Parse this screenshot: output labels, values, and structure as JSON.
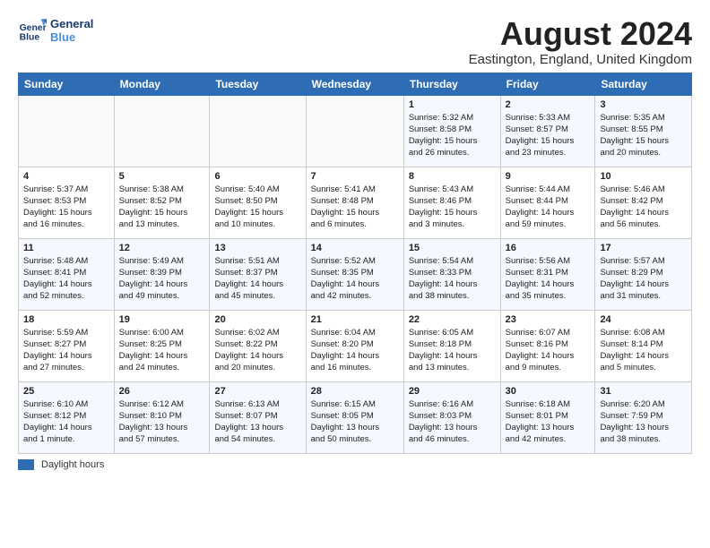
{
  "header": {
    "logo_line1": "General",
    "logo_line2": "Blue",
    "month_title": "August 2024",
    "location": "Eastington, England, United Kingdom"
  },
  "weekdays": [
    "Sunday",
    "Monday",
    "Tuesday",
    "Wednesday",
    "Thursday",
    "Friday",
    "Saturday"
  ],
  "weeks": [
    [
      {
        "day": "",
        "info": ""
      },
      {
        "day": "",
        "info": ""
      },
      {
        "day": "",
        "info": ""
      },
      {
        "day": "",
        "info": ""
      },
      {
        "day": "1",
        "info": "Sunrise: 5:32 AM\nSunset: 8:58 PM\nDaylight: 15 hours\nand 26 minutes."
      },
      {
        "day": "2",
        "info": "Sunrise: 5:33 AM\nSunset: 8:57 PM\nDaylight: 15 hours\nand 23 minutes."
      },
      {
        "day": "3",
        "info": "Sunrise: 5:35 AM\nSunset: 8:55 PM\nDaylight: 15 hours\nand 20 minutes."
      }
    ],
    [
      {
        "day": "4",
        "info": "Sunrise: 5:37 AM\nSunset: 8:53 PM\nDaylight: 15 hours\nand 16 minutes."
      },
      {
        "day": "5",
        "info": "Sunrise: 5:38 AM\nSunset: 8:52 PM\nDaylight: 15 hours\nand 13 minutes."
      },
      {
        "day": "6",
        "info": "Sunrise: 5:40 AM\nSunset: 8:50 PM\nDaylight: 15 hours\nand 10 minutes."
      },
      {
        "day": "7",
        "info": "Sunrise: 5:41 AM\nSunset: 8:48 PM\nDaylight: 15 hours\nand 6 minutes."
      },
      {
        "day": "8",
        "info": "Sunrise: 5:43 AM\nSunset: 8:46 PM\nDaylight: 15 hours\nand 3 minutes."
      },
      {
        "day": "9",
        "info": "Sunrise: 5:44 AM\nSunset: 8:44 PM\nDaylight: 14 hours\nand 59 minutes."
      },
      {
        "day": "10",
        "info": "Sunrise: 5:46 AM\nSunset: 8:42 PM\nDaylight: 14 hours\nand 56 minutes."
      }
    ],
    [
      {
        "day": "11",
        "info": "Sunrise: 5:48 AM\nSunset: 8:41 PM\nDaylight: 14 hours\nand 52 minutes."
      },
      {
        "day": "12",
        "info": "Sunrise: 5:49 AM\nSunset: 8:39 PM\nDaylight: 14 hours\nand 49 minutes."
      },
      {
        "day": "13",
        "info": "Sunrise: 5:51 AM\nSunset: 8:37 PM\nDaylight: 14 hours\nand 45 minutes."
      },
      {
        "day": "14",
        "info": "Sunrise: 5:52 AM\nSunset: 8:35 PM\nDaylight: 14 hours\nand 42 minutes."
      },
      {
        "day": "15",
        "info": "Sunrise: 5:54 AM\nSunset: 8:33 PM\nDaylight: 14 hours\nand 38 minutes."
      },
      {
        "day": "16",
        "info": "Sunrise: 5:56 AM\nSunset: 8:31 PM\nDaylight: 14 hours\nand 35 minutes."
      },
      {
        "day": "17",
        "info": "Sunrise: 5:57 AM\nSunset: 8:29 PM\nDaylight: 14 hours\nand 31 minutes."
      }
    ],
    [
      {
        "day": "18",
        "info": "Sunrise: 5:59 AM\nSunset: 8:27 PM\nDaylight: 14 hours\nand 27 minutes."
      },
      {
        "day": "19",
        "info": "Sunrise: 6:00 AM\nSunset: 8:25 PM\nDaylight: 14 hours\nand 24 minutes."
      },
      {
        "day": "20",
        "info": "Sunrise: 6:02 AM\nSunset: 8:22 PM\nDaylight: 14 hours\nand 20 minutes."
      },
      {
        "day": "21",
        "info": "Sunrise: 6:04 AM\nSunset: 8:20 PM\nDaylight: 14 hours\nand 16 minutes."
      },
      {
        "day": "22",
        "info": "Sunrise: 6:05 AM\nSunset: 8:18 PM\nDaylight: 14 hours\nand 13 minutes."
      },
      {
        "day": "23",
        "info": "Sunrise: 6:07 AM\nSunset: 8:16 PM\nDaylight: 14 hours\nand 9 minutes."
      },
      {
        "day": "24",
        "info": "Sunrise: 6:08 AM\nSunset: 8:14 PM\nDaylight: 14 hours\nand 5 minutes."
      }
    ],
    [
      {
        "day": "25",
        "info": "Sunrise: 6:10 AM\nSunset: 8:12 PM\nDaylight: 14 hours\nand 1 minute."
      },
      {
        "day": "26",
        "info": "Sunrise: 6:12 AM\nSunset: 8:10 PM\nDaylight: 13 hours\nand 57 minutes."
      },
      {
        "day": "27",
        "info": "Sunrise: 6:13 AM\nSunset: 8:07 PM\nDaylight: 13 hours\nand 54 minutes."
      },
      {
        "day": "28",
        "info": "Sunrise: 6:15 AM\nSunset: 8:05 PM\nDaylight: 13 hours\nand 50 minutes."
      },
      {
        "day": "29",
        "info": "Sunrise: 6:16 AM\nSunset: 8:03 PM\nDaylight: 13 hours\nand 46 minutes."
      },
      {
        "day": "30",
        "info": "Sunrise: 6:18 AM\nSunset: 8:01 PM\nDaylight: 13 hours\nand 42 minutes."
      },
      {
        "day": "31",
        "info": "Sunrise: 6:20 AM\nSunset: 7:59 PM\nDaylight: 13 hours\nand 38 minutes."
      }
    ]
  ],
  "legend": {
    "daylight_label": "Daylight hours"
  }
}
